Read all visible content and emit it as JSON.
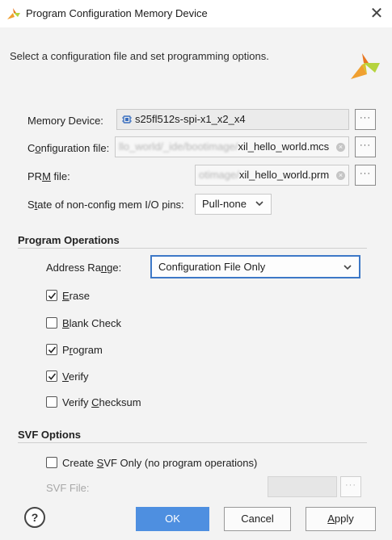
{
  "window": {
    "title": "Program Configuration Memory Device",
    "close_symbol": "✕",
    "app_icon": "xilinx-logo-icon"
  },
  "header": {
    "instruction": "Select a configuration file and set programming options."
  },
  "fields": {
    "memory_device": {
      "label": "Memory Device:",
      "value": "s25fl512s-spi-x1_x2_x4",
      "more": "···"
    },
    "configuration_file": {
      "label_pre": "C",
      "label_ul": "o",
      "label_post": "nfiguration file:",
      "value_blurred": "llo_world/_ide/bootimage/",
      "value": "xil_hello_world.mcs",
      "more": "···"
    },
    "prm_file": {
      "label_pre": "PR",
      "label_ul": "M",
      "label_post": " file:",
      "value_blurred": "otimage/",
      "value": "xil_hello_world.prm",
      "more": "···"
    },
    "state_pins": {
      "label_pre": "S",
      "label_ul": "t",
      "label_post": "ate of non-config mem I/O pins:",
      "value": "Pull-none"
    }
  },
  "program_operations": {
    "title": "Program Operations",
    "address_range": {
      "label_pre": "Address Ra",
      "label_ul": "n",
      "label_post": "ge:",
      "value": "Configuration File Only"
    },
    "checkboxes": [
      {
        "ul": "E",
        "rest": "rase",
        "pre": "",
        "checked": true
      },
      {
        "ul": "B",
        "rest": "lank Check",
        "pre": "",
        "checked": false
      },
      {
        "pre": "P",
        "ul": "r",
        "rest": "ogram",
        "checked": true
      },
      {
        "ul": "V",
        "rest": "erify",
        "pre": "",
        "checked": true
      },
      {
        "pre": "Verify ",
        "ul": "C",
        "rest": "hecksum",
        "checked": false
      }
    ]
  },
  "svf_options": {
    "title": "SVF Options",
    "create_svf": {
      "pre": "Create ",
      "ul": "S",
      "rest": "VF Only (no program operations)",
      "checked": false
    },
    "svf_file_label": "SVF File:",
    "svf_file_value": "",
    "more": "···"
  },
  "footer": {
    "help": "?",
    "ok": "OK",
    "cancel": "Cancel",
    "apply_ul": "A",
    "apply_rest": "pply"
  },
  "colors": {
    "accent": "#4e8fe0",
    "focus_border": "#3d78c7",
    "panel_bg": "#f3f3f3",
    "xilinx_orange": "#e87722",
    "xilinx_green": "#b5d33d"
  }
}
